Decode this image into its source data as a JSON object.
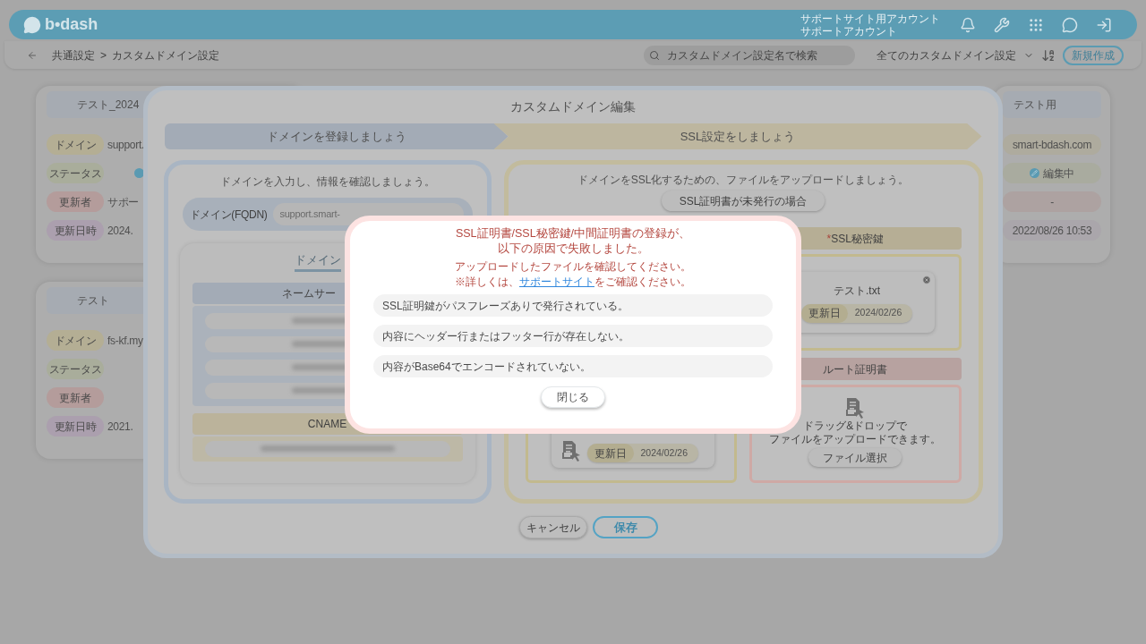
{
  "header": {
    "logo": "b•dash",
    "account_lines": [
      "サポートサイト用アカウント",
      "サポートアカウント"
    ]
  },
  "toolbar": {
    "breadcrumb": [
      "共通設定",
      "カスタムドメイン設定"
    ],
    "separator": ">",
    "search": {
      "placeholder": "カスタムドメイン設定名で検索"
    },
    "filter": "全てのカスタムドメイン設定",
    "new_button": "新規作成"
  },
  "cards_left": [
    {
      "title": "テスト_2024",
      "rows": [
        {
          "kind": "text",
          "label": "ドメイン",
          "value": "support.",
          "color": "#b4ae94"
        },
        {
          "kind": "status",
          "label": "ステータス",
          "color": "#a9ad9b"
        },
        {
          "kind": "text",
          "label": "更新者",
          "value": "サポー",
          "color": "#b49c9b"
        },
        {
          "kind": "text",
          "label": "更新日時",
          "value": "2024.",
          "color": "#ab9fae"
        }
      ]
    },
    {
      "title": "テスト",
      "rows": [
        {
          "kind": "text",
          "label": "ドメイン",
          "value": "fs-kf.my",
          "color": "#b4ae94"
        },
        {
          "kind": "empty",
          "label": "ステータス",
          "color": "#a9ad9b"
        },
        {
          "kind": "empty",
          "label": "更新者",
          "color": "#b49c9b"
        },
        {
          "kind": "text",
          "label": "更新日時",
          "value": "2021.",
          "color": "#ab9fae"
        }
      ]
    }
  ],
  "card_right": {
    "title": "テスト用",
    "rows": [
      {
        "kind": "text",
        "value": "smart-bdash.com",
        "color": "#aeab9e"
      },
      {
        "kind": "status",
        "value": "編集中",
        "color": "#a9ab9f"
      },
      {
        "kind": "text",
        "value": "-",
        "color": "#ada2a1"
      },
      {
        "kind": "text",
        "value": "2022/08/26 10:53",
        "color": "#aaa6ab"
      }
    ]
  },
  "modal": {
    "title": "カスタムドメイン編集",
    "steps": [
      {
        "label": "ドメインを登録しましょう",
        "color": "#a3abb6"
      },
      {
        "label": "SSL設定をしましょう",
        "color": "#bdb69f"
      }
    ],
    "domain_panel": {
      "intro": "ドメインを入力し、情報を確認しましょう。",
      "fqdn": {
        "label": "ドメイン(FQDN)",
        "value": "support.smart-"
      },
      "info_title": "ドメイン",
      "nameserver_header": "ネームサー",
      "cname_header": "CNAME"
    },
    "ssl_panel": {
      "intro": "ドメインをSSL化するための、ファイルをアップロードしましょう。",
      "unissued_button": "SSL証明書が未発行の場合",
      "private_key": {
        "required_mark": "*",
        "header": "SSL秘密鍵",
        "file": {
          "name": "テスト.txt",
          "date_label": "更新日",
          "date": "2024/02/26"
        }
      },
      "intermediate_file": {
        "date_label": "更新日",
        "date": "2024/02/26"
      },
      "root_cert": {
        "header": "ルート証明書",
        "drop_text": [
          "ドラッグ&ドロップで",
          "ファイルをアップロードできます。"
        ],
        "select_button": "ファイル選択"
      }
    },
    "cancel_button": "キャンセル",
    "save_button": "保存"
  },
  "error_dialog": {
    "title_lines": [
      "SSL証明書/SSL秘密鍵/中間証明書の登録が、",
      "以下の原因で失敗しました。"
    ],
    "message": "アップロードしたファイルを確認してください。",
    "note": {
      "before": "※詳しくは、",
      "link": "サポートサイト",
      "after": "をご確認ください。"
    },
    "reasons": [
      "SSL証明鍵がパスフレーズありで発行されている。",
      "内容にヘッダー行またはフッター行が存在しない。",
      "内容がBase64でエンコードされていない。"
    ],
    "close_button": "閉じる"
  }
}
